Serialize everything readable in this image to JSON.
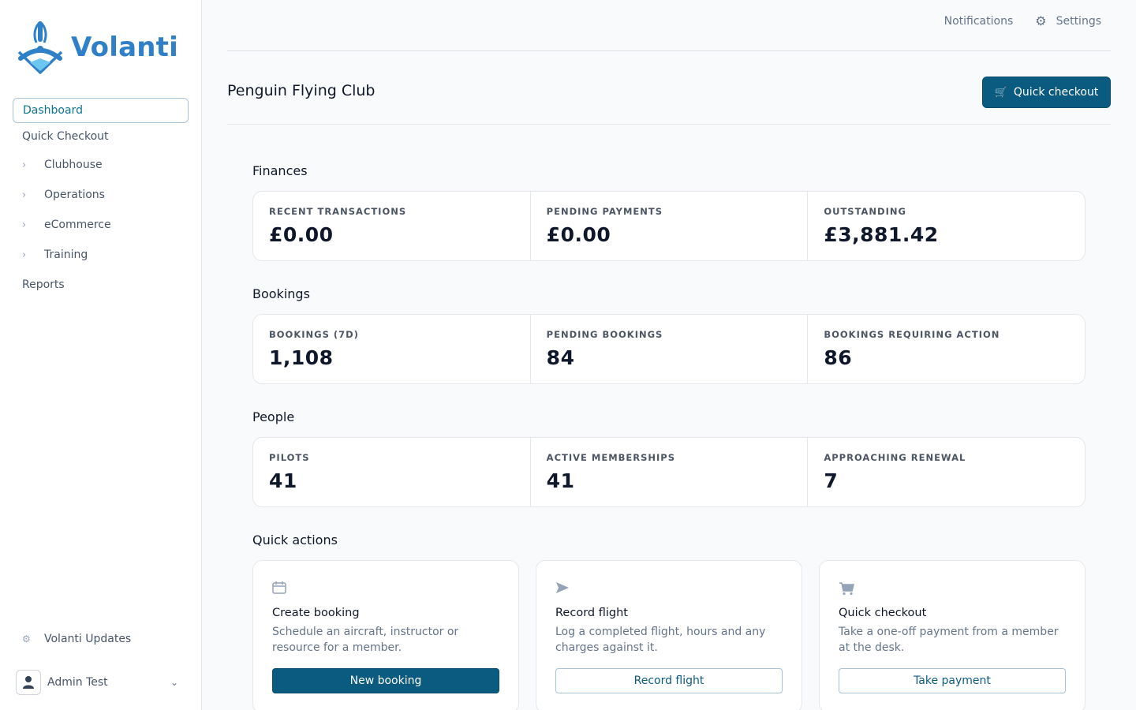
{
  "brand": {
    "name": "Volanti",
    "logo_icon": "volanti-propeller-logo",
    "color": "#2f80c8"
  },
  "sidebar": {
    "items": [
      {
        "label": "Dashboard",
        "active": true
      },
      {
        "label": "Quick Checkout"
      },
      {
        "label": "Clubhouse",
        "expandable": true
      },
      {
        "label": "Operations",
        "expandable": true
      },
      {
        "label": "eCommerce",
        "expandable": true
      },
      {
        "label": "Training",
        "expandable": true
      },
      {
        "label": "Reports"
      }
    ],
    "updates_label": "Volanti Updates",
    "user_name": "Admin Test"
  },
  "topbar": {
    "notifications": "Notifications",
    "settings": "Settings"
  },
  "page": {
    "title": "Penguin Flying Club",
    "quick_checkout_button": "Quick checkout"
  },
  "sections": {
    "finances": {
      "title": "Finances",
      "stats": [
        {
          "label": "RECENT TRANSACTIONS",
          "value": "£0.00"
        },
        {
          "label": "PENDING PAYMENTS",
          "value": "£0.00"
        },
        {
          "label": "OUTSTANDING",
          "value": "£3,881.42"
        }
      ]
    },
    "bookings": {
      "title": "Bookings",
      "stats": [
        {
          "label": "BOOKINGS (7D)",
          "value": "1,108"
        },
        {
          "label": "PENDING BOOKINGS",
          "value": "84"
        },
        {
          "label": "BOOKINGS REQUIRING ACTION",
          "value": "86"
        }
      ]
    },
    "people": {
      "title": "People",
      "stats": [
        {
          "label": "PILOTS",
          "value": "41"
        },
        {
          "label": "ACTIVE MEMBERSHIPS",
          "value": "41"
        },
        {
          "label": "APPROACHING RENEWAL",
          "value": "7"
        }
      ]
    }
  },
  "quick_actions": {
    "title": "Quick actions",
    "cards": [
      {
        "icon": "calendar-icon",
        "title": "Create booking",
        "description": "Schedule an aircraft, instructor or resource for a member.",
        "button": "New booking"
      },
      {
        "icon": "paper-plane-icon",
        "title": "Record flight",
        "description": "Log a completed flight, hours and any charges against it.",
        "button": "Record flight"
      },
      {
        "icon": "cart-icon",
        "title": "Quick checkout",
        "description": "Take a one-off payment from a member at the desk.",
        "button": "Take payment"
      }
    ]
  },
  "colors": {
    "primary": "#0b5a80",
    "accent_text": "#0e7490",
    "background": "#f8fafc"
  }
}
